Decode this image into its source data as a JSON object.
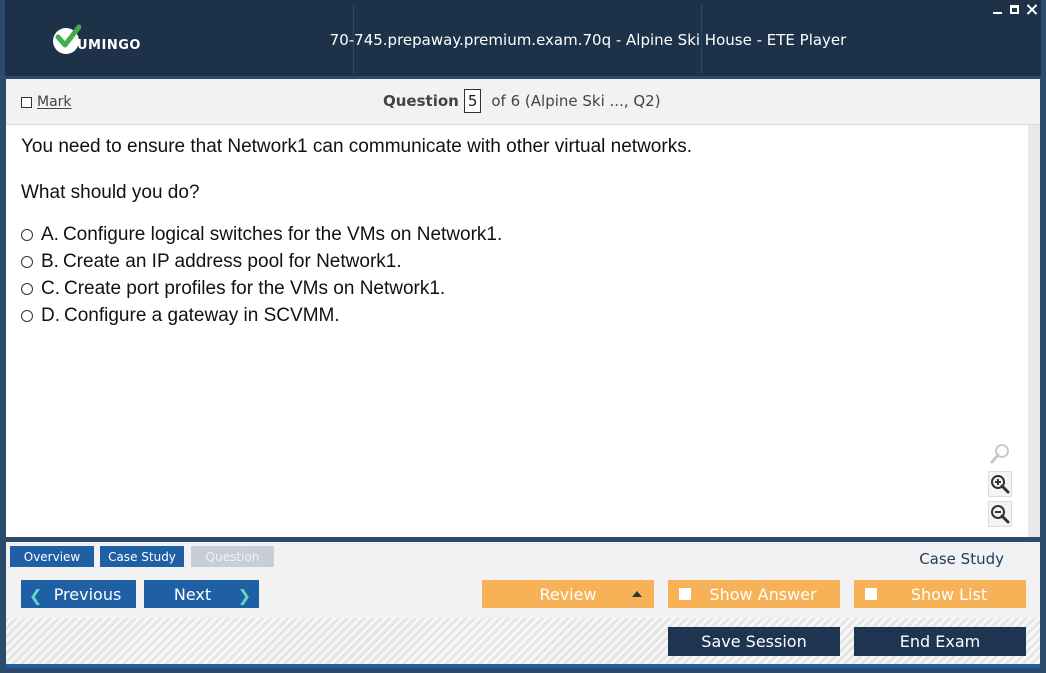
{
  "window": {
    "title": "70-745.prepaway.premium.exam.70q - Alpine Ski House - ETE Player",
    "logo_text": "UMINGO",
    "controls": [
      "minimize-icon",
      "maximize-icon",
      "close-icon"
    ]
  },
  "header": {
    "mark_label": "Mark",
    "question_label": "Question",
    "question_number": "5",
    "question_of": "of 6 (Alpine Ski ..., Q2)"
  },
  "question": {
    "text": "You need to ensure that Network1 can communicate with other virtual networks.",
    "prompt": "What should you do?",
    "options": [
      {
        "letter": "A.",
        "text": "Configure logical switches for the VMs on Network1."
      },
      {
        "letter": "B.",
        "text": "Create an IP address pool for Network1."
      },
      {
        "letter": "C.",
        "text": "Create port profiles for the VMs on Network1."
      },
      {
        "letter": "D.",
        "text": "Configure a gateway in SCVMM."
      }
    ]
  },
  "tabs": {
    "overview": "Overview",
    "case_study": "Case Study",
    "question": "Question",
    "case_study_link": "Case Study"
  },
  "nav": {
    "previous": "Previous",
    "next": "Next",
    "review": "Review",
    "show_answer": "Show Answer",
    "show_list": "Show List"
  },
  "footer": {
    "save_session": "Save Session",
    "end_exam": "End Exam"
  },
  "colors": {
    "titlebar": "#1d3148",
    "accent_blue": "#1f5fa3",
    "accent_orange": "#f7b257",
    "dark_button": "#1d3550"
  }
}
